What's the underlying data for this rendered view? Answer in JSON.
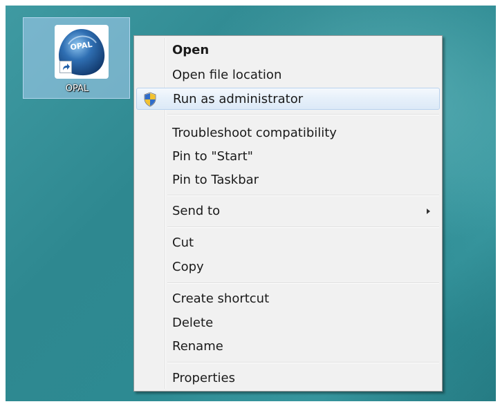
{
  "desktop": {
    "icon": {
      "label": "OPAL",
      "logo_text": "OPAL",
      "icon_name": "opal-app-icon"
    }
  },
  "context_menu": {
    "items": [
      {
        "label": "Open",
        "bold": true
      },
      {
        "label": "Open file location"
      },
      {
        "label": "Run as administrator",
        "icon": "uac-shield-icon",
        "highlighted": true
      },
      {
        "label": "Troubleshoot compatibility"
      },
      {
        "label": "Pin to \"Start\""
      },
      {
        "label": "Pin to Taskbar"
      },
      {
        "label": "Send to",
        "submenu": true
      },
      {
        "label": "Cut"
      },
      {
        "label": "Copy"
      },
      {
        "label": "Create shortcut"
      },
      {
        "label": "Delete"
      },
      {
        "label": "Rename"
      },
      {
        "label": "Properties"
      }
    ]
  },
  "colors": {
    "desktop_background": "#2e8890",
    "selection_highlight": "#dce9f7",
    "menu_background": "#f1f1f1"
  }
}
